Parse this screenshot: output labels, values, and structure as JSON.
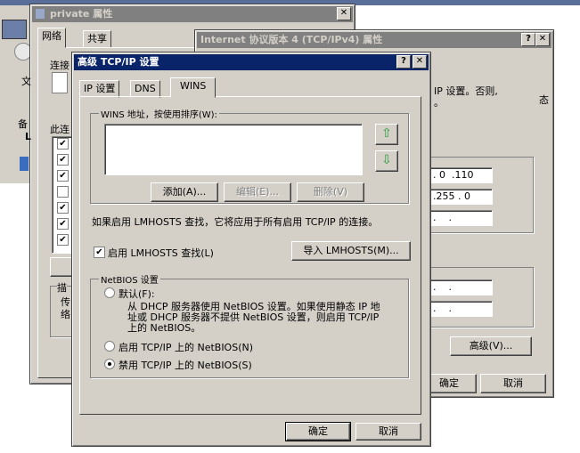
{
  "private_window": {
    "title": "private 属性",
    "tabs": [
      "网络",
      "共享"
    ],
    "connect_label": "连接",
    "this_conn_label": "此连",
    "desc_label": "描",
    "side_chars": [
      "文",
      "备",
      "L",
      "传",
      "络"
    ],
    "list_checks": [
      true,
      true,
      true,
      false,
      true,
      true,
      true
    ],
    "close_glyph": "✕"
  },
  "ipv4_window": {
    "title": "Internet 协议版本 4 (TCP/IPv4) 属性",
    "text_line1": "IP 设置。否则,",
    "text_line2": "。",
    "text_suffix": "态",
    "ip_rows": [
      ". 0  .110",
      ".255 . 0",
      ".    .",
      ".    .",
      ".    ."
    ],
    "advanced_button": "高级(V)...",
    "ok_button": "确定",
    "cancel_button": "取消",
    "help_glyph": "?",
    "close_glyph": "✕"
  },
  "adv_dialog": {
    "title": "高级 TCP/IP 设置",
    "help_glyph": "?",
    "close_glyph": "✕",
    "tabs": [
      "IP 设置",
      "DNS",
      "WINS"
    ],
    "wins_group_label": "WINS 地址，按使用排序(W):",
    "up_arrow": "⇧",
    "down_arrow": "⇩",
    "add_button": "添加(A)...",
    "edit_button": "编辑(E)...",
    "remove_button": "删除(V)",
    "lmhosts_info": "如果启用 LMHOSTS 查找，它将应用于所有启用 TCP/IP 的连接。",
    "lmhosts_checkbox": "启用 LMHOSTS 查找(L)",
    "lmhosts_checked": true,
    "import_button": "导入 LMHOSTS(M)...",
    "netbios_group_label": "NetBIOS 设置",
    "netbios_options": [
      {
        "label": "默认(F):",
        "selected": false
      },
      {
        "label": "启用 TCP/IP 上的 NetBIOS(N)",
        "selected": false
      },
      {
        "label": "禁用 TCP/IP 上的 NetBIOS(S)",
        "selected": true
      }
    ],
    "default_desc": [
      "从 DHCP 服务器使用 NetBIOS 设置。如果使用静态 IP 地",
      "址或 DHCP 服务器不提供 NetBIOS 设置，则启用 TCP/IP",
      "上的 NetBIOS。"
    ],
    "ok_button": "确定",
    "cancel_button": "取消"
  }
}
